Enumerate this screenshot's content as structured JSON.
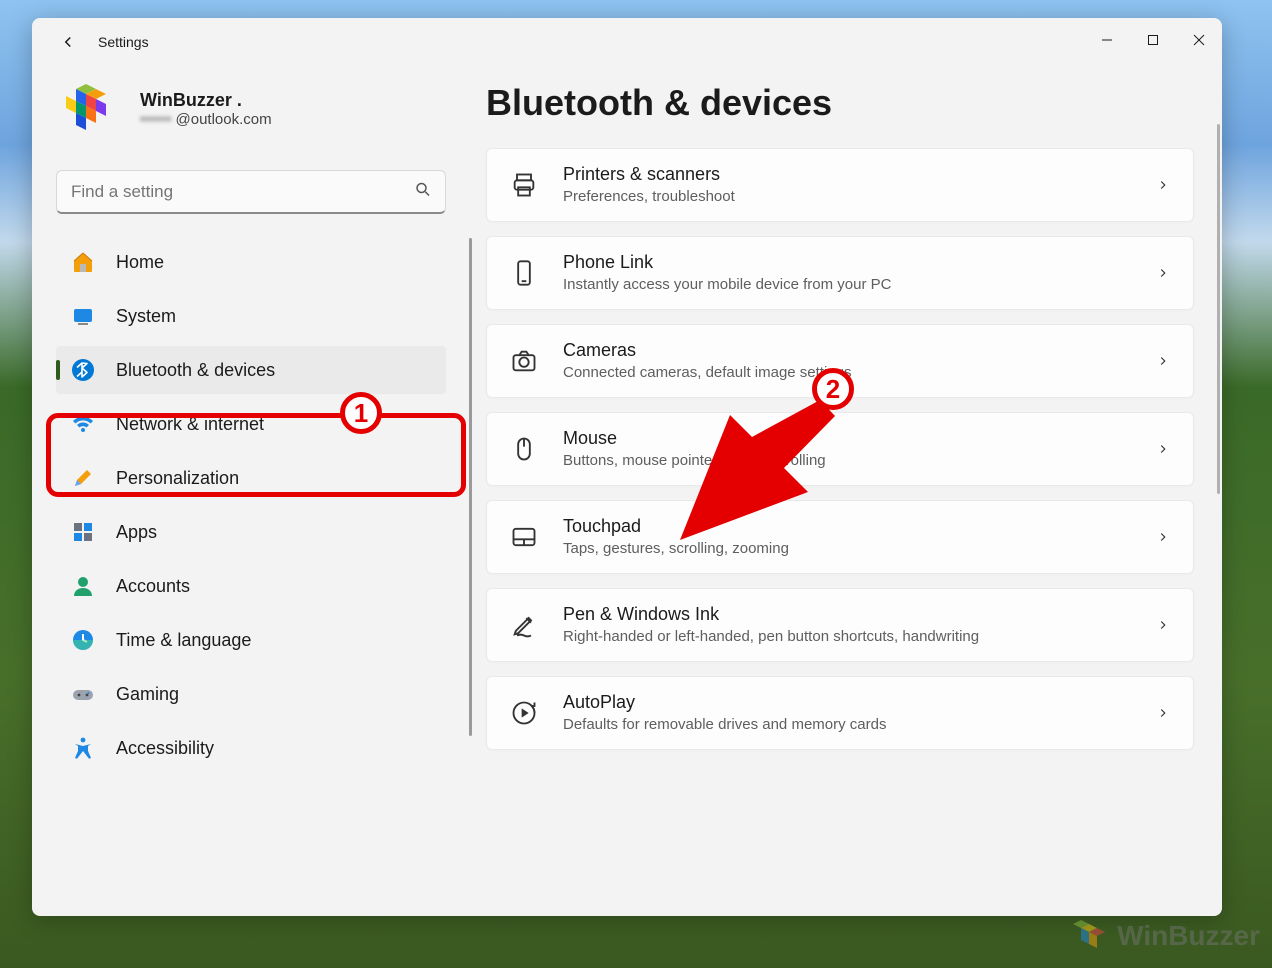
{
  "window": {
    "title": "Settings"
  },
  "user": {
    "name": "WinBuzzer .",
    "email_suffix": "@outlook.com"
  },
  "search": {
    "placeholder": "Find a setting"
  },
  "nav": {
    "items": [
      {
        "label": "Home"
      },
      {
        "label": "System"
      },
      {
        "label": "Bluetooth & devices"
      },
      {
        "label": "Network & internet"
      },
      {
        "label": "Personalization"
      },
      {
        "label": "Apps"
      },
      {
        "label": "Accounts"
      },
      {
        "label": "Time & language"
      },
      {
        "label": "Gaming"
      },
      {
        "label": "Accessibility"
      }
    ]
  },
  "page": {
    "title": "Bluetooth & devices"
  },
  "cards": [
    {
      "title": "Printers & scanners",
      "sub": "Preferences, troubleshoot"
    },
    {
      "title": "Phone Link",
      "sub": "Instantly access your mobile device from your PC"
    },
    {
      "title": "Cameras",
      "sub": "Connected cameras, default image settings"
    },
    {
      "title": "Mouse",
      "sub": "Buttons, mouse pointer speed, scrolling"
    },
    {
      "title": "Touchpad",
      "sub": "Taps, gestures, scrolling, zooming"
    },
    {
      "title": "Pen & Windows Ink",
      "sub": "Right-handed or left-handed, pen button shortcuts, handwriting"
    },
    {
      "title": "AutoPlay",
      "sub": "Defaults for removable drives and memory cards"
    }
  ],
  "annotations": {
    "one": "1",
    "two": "2"
  },
  "watermark": "WinBuzzer"
}
